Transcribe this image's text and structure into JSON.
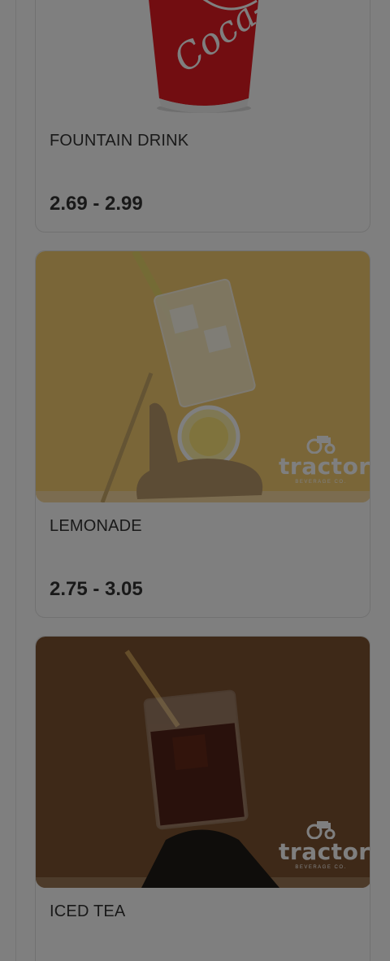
{
  "menu_items": [
    {
      "name": "FOUNTAIN DRINK",
      "price": "2.69 - 2.99",
      "image": "coca-cola-cup-photo"
    },
    {
      "name": "LEMONADE",
      "price": "2.75 - 3.05",
      "image": "lemonade-glass-photo"
    },
    {
      "name": "ICED TEA",
      "price": "",
      "image": "iced-tea-glass-photo"
    }
  ],
  "watermark": {
    "brand": "tractor",
    "sub": "BEVERAGE CO.",
    "icon": "tractor-icon"
  },
  "coke_logo_text": "Coca-Cola",
  "colors": {
    "overlay": "rgba(0,0,0,0.5)",
    "lemonade_bg": "#f4cc71",
    "iced_tea_bg": "#7d5230",
    "coke_red": "#e41b23"
  }
}
